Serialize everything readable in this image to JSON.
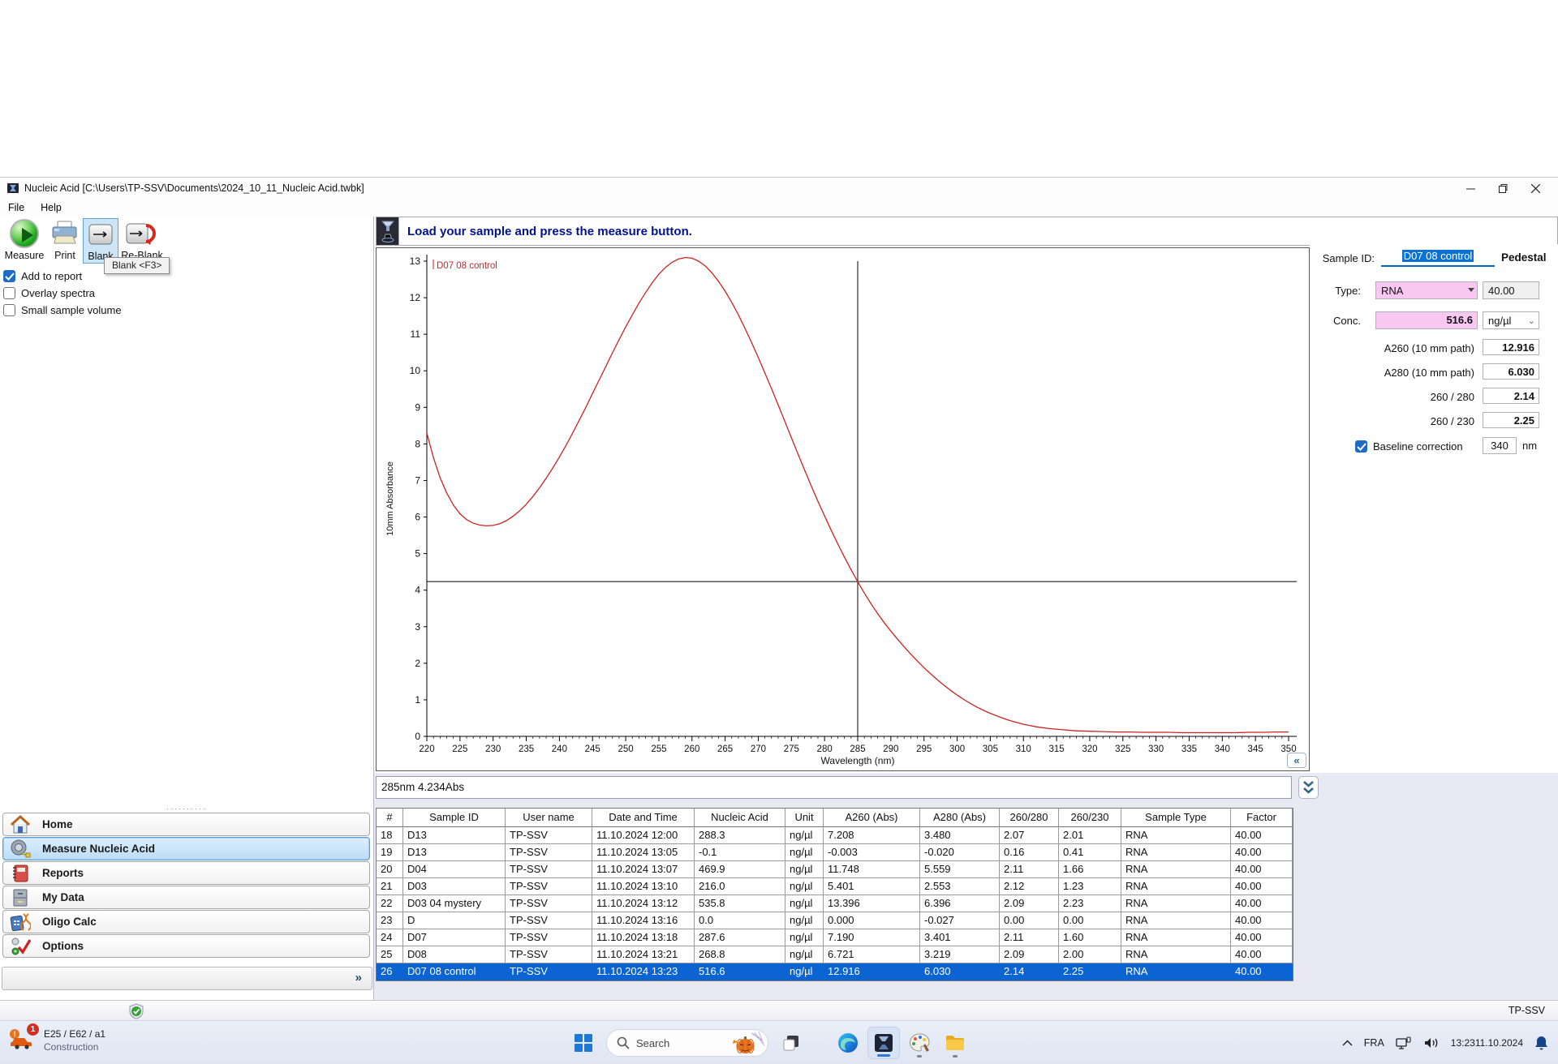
{
  "window": {
    "title": "Nucleic Acid  [C:\\Users\\TP-SSV\\Documents\\2024_10_11_Nucleic Acid.twbk]"
  },
  "menu": {
    "items": [
      "File",
      "Help"
    ]
  },
  "toolbar": {
    "buttons": [
      {
        "label": "Measure"
      },
      {
        "label": "Print"
      },
      {
        "label": "Blank"
      },
      {
        "label": "Re-Blank"
      }
    ],
    "selected": "Blank",
    "tooltip": "Blank <F3>"
  },
  "checkboxes": [
    {
      "label": "Add to report",
      "checked": true
    },
    {
      "label": "Overlay spectra",
      "checked": false
    },
    {
      "label": "Small sample volume",
      "checked": false
    }
  ],
  "sidebar": {
    "selected_index": 1,
    "items": [
      {
        "label": "Home"
      },
      {
        "label": "Measure Nucleic Acid"
      },
      {
        "label": "Reports"
      },
      {
        "label": "My Data"
      },
      {
        "label": "Oligo Calc"
      },
      {
        "label": "Options"
      }
    ],
    "expander": "»"
  },
  "message": "Load your sample and press the measure button.",
  "chart_data": {
    "type": "line",
    "xlabel": "Wavelength (nm)",
    "ylabel": "10mm Absorbance",
    "xlim": [
      220,
      350
    ],
    "ylim": [
      0,
      13
    ],
    "x_tick_step": 5,
    "y_tick_step": 1,
    "grid": false,
    "annotation": "D07 08 control",
    "crosshair": {
      "x": 285,
      "y": 4.234
    },
    "series": [
      {
        "name": "D07 08 control",
        "color": "#cc2222",
        "points": [
          [
            220,
            8.3
          ],
          [
            221,
            7.62
          ],
          [
            222,
            7.08
          ],
          [
            223,
            6.66
          ],
          [
            224,
            6.33
          ],
          [
            225,
            6.09
          ],
          [
            226,
            5.93
          ],
          [
            227,
            5.83
          ],
          [
            228,
            5.78
          ],
          [
            229,
            5.76
          ],
          [
            230,
            5.77
          ],
          [
            231,
            5.82
          ],
          [
            232,
            5.9
          ],
          [
            233,
            6.02
          ],
          [
            234,
            6.17
          ],
          [
            235,
            6.35
          ],
          [
            236,
            6.56
          ],
          [
            237,
            6.8
          ],
          [
            238,
            7.06
          ],
          [
            239,
            7.34
          ],
          [
            240,
            7.64
          ],
          [
            241,
            7.96
          ],
          [
            242,
            8.3
          ],
          [
            243,
            8.65
          ],
          [
            244,
            9.01
          ],
          [
            245,
            9.38
          ],
          [
            246,
            9.75
          ],
          [
            247,
            10.12
          ],
          [
            248,
            10.49
          ],
          [
            249,
            10.85
          ],
          [
            250,
            11.2
          ],
          [
            251,
            11.53
          ],
          [
            252,
            11.85
          ],
          [
            253,
            12.14
          ],
          [
            254,
            12.41
          ],
          [
            255,
            12.64
          ],
          [
            256,
            12.83
          ],
          [
            257,
            12.97
          ],
          [
            258,
            13.06
          ],
          [
            259,
            13.1
          ],
          [
            260,
            13.08
          ],
          [
            261,
            13.0
          ],
          [
            262,
            12.87
          ],
          [
            263,
            12.68
          ],
          [
            264,
            12.45
          ],
          [
            265,
            12.18
          ],
          [
            266,
            11.87
          ],
          [
            267,
            11.53
          ],
          [
            268,
            11.16
          ],
          [
            269,
            10.77
          ],
          [
            270,
            10.36
          ],
          [
            271,
            9.94
          ],
          [
            272,
            9.51
          ],
          [
            273,
            9.07
          ],
          [
            274,
            8.62
          ],
          [
            275,
            8.17
          ],
          [
            276,
            7.72
          ],
          [
            277,
            7.28
          ],
          [
            278,
            6.85
          ],
          [
            279,
            6.43
          ],
          [
            280,
            6.03
          ],
          [
            281,
            5.64
          ],
          [
            282,
            5.26
          ],
          [
            283,
            4.9
          ],
          [
            284,
            4.56
          ],
          [
            285,
            4.23
          ],
          [
            286,
            3.92
          ],
          [
            287,
            3.63
          ],
          [
            288,
            3.36
          ],
          [
            289,
            3.11
          ],
          [
            290,
            2.88
          ],
          [
            291,
            2.66
          ],
          [
            292,
            2.45
          ],
          [
            293,
            2.25
          ],
          [
            294,
            2.06
          ],
          [
            295,
            1.88
          ],
          [
            296,
            1.71
          ],
          [
            297,
            1.55
          ],
          [
            298,
            1.4
          ],
          [
            299,
            1.26
          ],
          [
            300,
            1.13
          ],
          [
            301,
            1.01
          ],
          [
            302,
            0.9
          ],
          [
            303,
            0.8
          ],
          [
            304,
            0.71
          ],
          [
            305,
            0.63
          ],
          [
            306,
            0.56
          ],
          [
            307,
            0.49
          ],
          [
            308,
            0.43
          ],
          [
            309,
            0.38
          ],
          [
            310,
            0.33
          ],
          [
            312,
            0.26
          ],
          [
            314,
            0.21
          ],
          [
            316,
            0.18
          ],
          [
            318,
            0.15
          ],
          [
            320,
            0.14
          ],
          [
            322,
            0.13
          ],
          [
            324,
            0.12
          ],
          [
            326,
            0.12
          ],
          [
            328,
            0.11
          ],
          [
            330,
            0.11
          ],
          [
            332,
            0.11
          ],
          [
            334,
            0.1
          ],
          [
            336,
            0.1
          ],
          [
            338,
            0.1
          ],
          [
            340,
            0.1
          ],
          [
            342,
            0.1
          ],
          [
            344,
            0.11
          ],
          [
            346,
            0.11
          ],
          [
            348,
            0.12
          ],
          [
            350,
            0.12
          ]
        ]
      }
    ]
  },
  "readout": "285nm 4.234Abs",
  "results": {
    "sample_id_label": "Sample ID:",
    "sample_id_value": "D07 08 control",
    "mode": "Pedestal",
    "type_label": "Type:",
    "type_value": "RNA",
    "factor_field": "40.00",
    "conc_label": "Conc.",
    "conc_value": "516.6",
    "conc_unit": "ng/µl",
    "a260_label": "A260 (10 mm path)",
    "a260_value": "12.916",
    "a280_label": "A280 (10 mm path)",
    "a280_value": "6.030",
    "ratio280_label": "260 / 280",
    "ratio280_value": "2.14",
    "ratio230_label": "260 / 230",
    "ratio230_value": "2.25",
    "baseline_label": "Baseline correction",
    "baseline_checked": true,
    "baseline_value": "340",
    "baseline_unit": "nm"
  },
  "table": {
    "columns": [
      "#",
      "Sample ID",
      "User name",
      "Date and Time",
      "Nucleic Acid",
      "Unit",
      "A260 (Abs)",
      "A280 (Abs)",
      "260/280",
      "260/230",
      "Sample Type",
      "Factor"
    ],
    "selected_index": 8,
    "rows": [
      [
        "18",
        "D13",
        "TP-SSV",
        "11.10.2024 12:00",
        "288.3",
        "ng/µl",
        "7.208",
        "3.480",
        "2.07",
        "2.01",
        "RNA",
        "40.00"
      ],
      [
        "19",
        "D13",
        "TP-SSV",
        "11.10.2024 13:05",
        "-0.1",
        "ng/µl",
        "-0.003",
        "-0.020",
        "0.16",
        "0.41",
        "RNA",
        "40.00"
      ],
      [
        "20",
        "D04",
        "TP-SSV",
        "11.10.2024 13:07",
        "469.9",
        "ng/µl",
        "11.748",
        "5.559",
        "2.11",
        "1.66",
        "RNA",
        "40.00"
      ],
      [
        "21",
        "D03",
        "TP-SSV",
        "11.10.2024 13:10",
        "216.0",
        "ng/µl",
        "5.401",
        "2.553",
        "2.12",
        "1.23",
        "RNA",
        "40.00"
      ],
      [
        "22",
        "D03 04 mystery",
        "TP-SSV",
        "11.10.2024 13:12",
        "535.8",
        "ng/µl",
        "13.396",
        "6.396",
        "2.09",
        "2.23",
        "RNA",
        "40.00"
      ],
      [
        "23",
        "D",
        "TP-SSV",
        "11.10.2024 13:16",
        "0.0",
        "ng/µl",
        "0.000",
        "-0.027",
        "0.00",
        "0.00",
        "RNA",
        "40.00"
      ],
      [
        "24",
        "D07",
        "TP-SSV",
        "11.10.2024 13:18",
        "287.6",
        "ng/µl",
        "7.190",
        "3.401",
        "2.11",
        "1.60",
        "RNA",
        "40.00"
      ],
      [
        "25",
        "D08",
        "TP-SSV",
        "11.10.2024 13:21",
        "268.8",
        "ng/µl",
        "6.721",
        "3.219",
        "2.09",
        "2.00",
        "RNA",
        "40.00"
      ],
      [
        "26",
        "D07 08 control",
        "TP-SSV",
        "11.10.2024 13:23",
        "516.6",
        "ng/µl",
        "12.916",
        "6.030",
        "2.14",
        "2.25",
        "RNA",
        "40.00"
      ]
    ]
  },
  "statusbar": {
    "user": "TP-SSV"
  },
  "taskbar": {
    "widget_line1": "E25 / E62 / a1",
    "widget_line2": "Construction",
    "widget_badge": "1",
    "search_placeholder": "Search",
    "language": "FRA",
    "time": "13:23",
    "date": "11.10.2024"
  }
}
